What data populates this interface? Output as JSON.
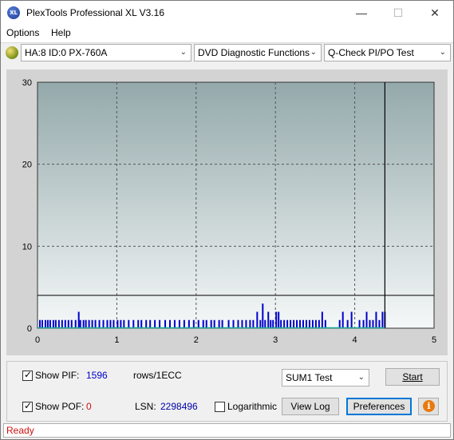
{
  "window": {
    "title": "PlexTools Professional XL V3.16",
    "icon_text": "XL"
  },
  "menu": {
    "options": "Options",
    "help": "Help"
  },
  "toolbar": {
    "drive": "HA:8 ID:0  PX-760A",
    "function": "DVD Diagnostic Functions",
    "test": "Q-Check PI/PO Test"
  },
  "chart_data": {
    "type": "bar",
    "x_ticks": [
      "0",
      "1",
      "2",
      "3",
      "4",
      "5"
    ],
    "y_ticks": [
      "0",
      "10",
      "20",
      "30"
    ],
    "xlim": [
      0,
      5
    ],
    "ylim": [
      0,
      30
    ],
    "grid": true,
    "threshold_line": 4,
    "end_marker_x": 4.38,
    "bar_color": "#0000cc",
    "series": [
      {
        "values": [
          [
            0.02,
            1
          ],
          [
            0.05,
            1
          ],
          [
            0.09,
            1
          ],
          [
            0.12,
            1
          ],
          [
            0.15,
            1
          ],
          [
            0.19,
            1
          ],
          [
            0.22,
            1
          ],
          [
            0.26,
            1
          ],
          [
            0.3,
            1
          ],
          [
            0.34,
            1
          ],
          [
            0.38,
            1
          ],
          [
            0.42,
            1
          ],
          [
            0.47,
            1
          ],
          [
            0.51,
            2
          ],
          [
            0.53,
            1
          ],
          [
            0.57,
            1
          ],
          [
            0.6,
            1
          ],
          [
            0.64,
            1
          ],
          [
            0.68,
            1
          ],
          [
            0.72,
            1
          ],
          [
            0.77,
            1
          ],
          [
            0.82,
            1
          ],
          [
            0.87,
            1
          ],
          [
            0.91,
            1
          ],
          [
            0.95,
            1
          ],
          [
            1.0,
            1
          ],
          [
            1.04,
            1
          ],
          [
            1.08,
            1
          ],
          [
            1.14,
            1
          ],
          [
            1.2,
            1
          ],
          [
            1.26,
            1
          ],
          [
            1.3,
            1
          ],
          [
            1.36,
            1
          ],
          [
            1.41,
            1
          ],
          [
            1.47,
            1
          ],
          [
            1.53,
            1
          ],
          [
            1.6,
            1
          ],
          [
            1.66,
            1
          ],
          [
            1.72,
            1
          ],
          [
            1.78,
            1
          ],
          [
            1.84,
            1
          ],
          [
            1.9,
            1
          ],
          [
            1.96,
            1
          ],
          [
            2.02,
            1
          ],
          [
            2.08,
            1
          ],
          [
            2.12,
            1
          ],
          [
            2.18,
            1
          ],
          [
            2.22,
            1
          ],
          [
            2.28,
            1
          ],
          [
            2.32,
            1
          ],
          [
            2.4,
            1
          ],
          [
            2.46,
            1
          ],
          [
            2.52,
            1
          ],
          [
            2.57,
            1
          ],
          [
            2.62,
            1
          ],
          [
            2.67,
            1
          ],
          [
            2.71,
            1
          ],
          [
            2.76,
            2
          ],
          [
            2.8,
            1
          ],
          [
            2.83,
            3
          ],
          [
            2.86,
            1
          ],
          [
            2.9,
            2
          ],
          [
            2.93,
            1
          ],
          [
            2.96,
            1
          ],
          [
            3.0,
            2
          ],
          [
            3.03,
            2
          ],
          [
            3.06,
            1
          ],
          [
            3.1,
            1
          ],
          [
            3.14,
            1
          ],
          [
            3.18,
            1
          ],
          [
            3.22,
            1
          ],
          [
            3.26,
            1
          ],
          [
            3.3,
            1
          ],
          [
            3.34,
            1
          ],
          [
            3.38,
            1
          ],
          [
            3.42,
            1
          ],
          [
            3.46,
            1
          ],
          [
            3.5,
            1
          ],
          [
            3.54,
            1
          ],
          [
            3.58,
            2
          ],
          [
            3.62,
            1
          ],
          [
            3.8,
            1
          ],
          [
            3.84,
            2
          ],
          [
            3.9,
            1
          ],
          [
            3.95,
            2
          ],
          [
            4.05,
            1
          ],
          [
            4.1,
            1
          ],
          [
            4.14,
            2
          ],
          [
            4.18,
            1
          ],
          [
            4.22,
            1
          ],
          [
            4.26,
            2
          ],
          [
            4.3,
            1
          ],
          [
            4.34,
            2
          ],
          [
            4.37,
            2
          ]
        ]
      }
    ]
  },
  "controls": {
    "show_pif_label": "Show PIF:",
    "pif_value": "1596",
    "rows_label": "rows/1ECC",
    "show_pof_label": "Show POF:",
    "pof_value": "0",
    "lsn_label": "LSN:",
    "lsn_value": "2298496",
    "log_label": "Logarithmic",
    "sum_select": "SUM1 Test",
    "start": "Start",
    "view_log": "View Log",
    "preferences": "Preferences",
    "info_symbol": "i"
  },
  "status": {
    "text": "Ready"
  }
}
